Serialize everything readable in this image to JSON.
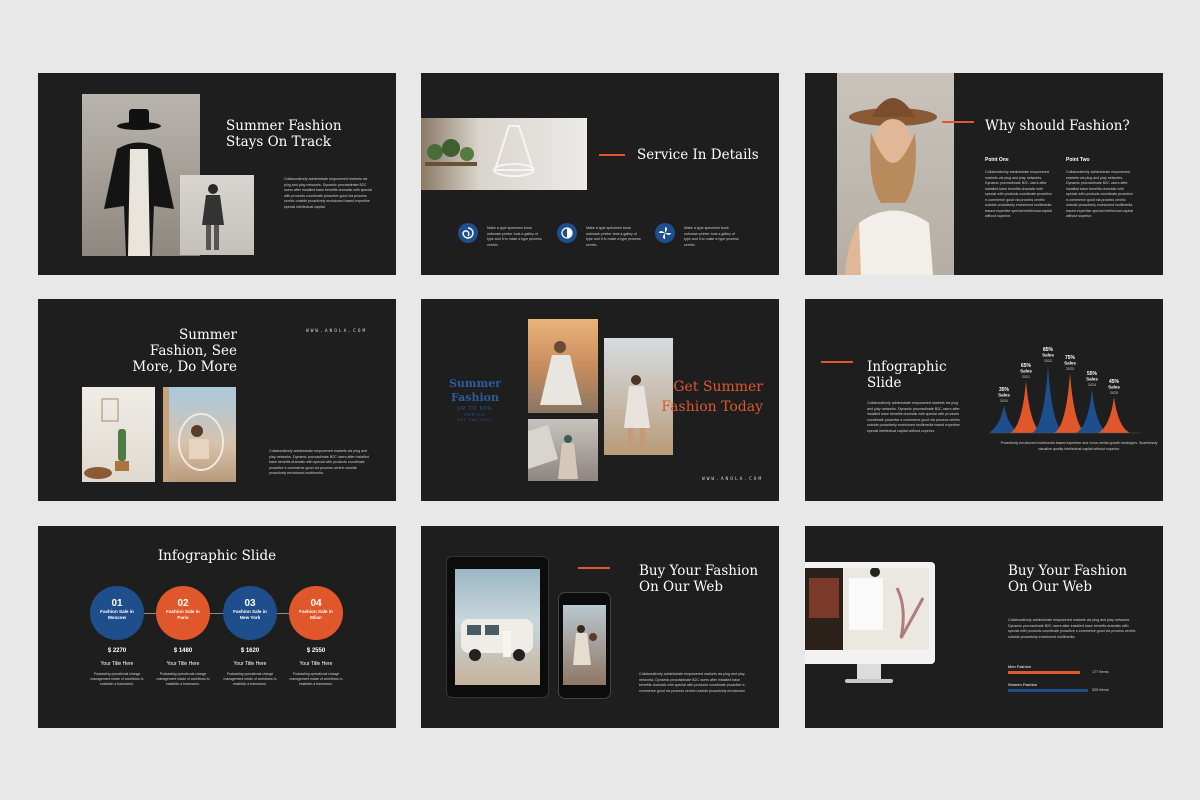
{
  "colors": {
    "background": "#e8e8e8",
    "slide": "#1e1e1f",
    "accent_orange": "#e0572b",
    "accent_blue": "#1f4e8c"
  },
  "slide1": {
    "title": "Summer Fashion Stays On Track",
    "body": "Collaboratively administrate empowered markets via plug and play networks. Dynamic procrastinate B2C users after installed base benefits dramatic with special with products coordinate proactive good via process centric outside proactively envisioned based expertise special intellectual capital."
  },
  "slide2": {
    "title": "Service In Details",
    "items": [
      {
        "icon": "spiral-icon",
        "text": "Make a type specimen book unknown printer took a galley of type and it to make a type process centric."
      },
      {
        "icon": "half-circle-icon",
        "text": "Make a type specimen book unknown printer took a galley of type and it to make a type process centric."
      },
      {
        "icon": "fan-icon",
        "text": "Make a type specimen book unknown printer took a galley of type and it to make a type process centric."
      }
    ]
  },
  "slide3": {
    "title": "Why should Fashion?",
    "points": [
      {
        "heading": "Point One",
        "text": "Collaboratively administrate empowered markets via plug and play networks. Dynamic procrastinate B2C users after installed base benefits dramatic with special with products coordinate proactive e-commerce good via process centric outside proactively envisioned multimedia based expertise special intellectual capital without superior."
      },
      {
        "heading": "Point Two",
        "text": "Collaboratively administrate empowered markets via plug and play networks. Dynamic procrastinate B2C users after installed base benefits dramatic with special with products coordinate proactive e-commerce good via process centric outside proactively envisioned multimedia based expertise special intellectual capital without superior."
      }
    ]
  },
  "slide4": {
    "title": "Summer Fashion, See More, Do More",
    "url": "WWW.ANOLA.COM",
    "body": "Collaboratively administrate empowered markets via plug and play networks. Dynamic procrastinate B2C users after installed base benefits dramatic with special with products coordinate proactive e-commerce good via process centric outside proactively envisioned multimedia."
  },
  "slide5": {
    "left_title": "Summer Fashion",
    "left_sub": "UP TO 60%",
    "left_period": "PERIOD",
    "left_date": "24T Jun 2021",
    "right_title": "Get Summer Fashion Today",
    "url": "WWW.ANOLA.COM"
  },
  "slide6": {
    "title": "Infographic Slide",
    "body": "Collaboratively administrate empowered markets via plug and play networks. Dynamic procrastinate B2C users after installed base benefits dramatic with special with products coordinate proactive e-commerce good via process centric outside proactively envisioned multimedia based expertise special intellectual capital without superior.",
    "footer": "Proactively envisioned multimedia based expertise and cross-media growth strategies. Seamlessly visualize quality intellectual capital without superior.",
    "peaks": [
      {
        "percent": "35%",
        "label": "Sales",
        "year": "2020",
        "value": 35,
        "color": "#1f4e8c"
      },
      {
        "percent": "65%",
        "label": "Sales",
        "year": "2021",
        "value": 65,
        "color": "#e0572b"
      },
      {
        "percent": "85%",
        "label": "Sales",
        "year": "2022",
        "value": 85,
        "color": "#1f4e8c"
      },
      {
        "percent": "75%",
        "label": "Sales",
        "year": "2023",
        "value": 75,
        "color": "#e0572b"
      },
      {
        "percent": "55%",
        "label": "Sales",
        "year": "2024",
        "value": 55,
        "color": "#1f4e8c"
      },
      {
        "percent": "45%",
        "label": "Sales",
        "year": "2025",
        "value": 45,
        "color": "#e0572b"
      }
    ]
  },
  "slide7": {
    "title": "Infographic Slide",
    "circles": [
      {
        "num": "01",
        "text": "Fashion Sale in Moscow",
        "price": "$ 2270",
        "heading": "Your Title Here",
        "desc": "Podcasting operational change management inside of workflows to establish a framework.",
        "color": "#1f4e8c"
      },
      {
        "num": "02",
        "text": "Fashion Sale in Paris",
        "price": "$ 1480",
        "heading": "Your Title Here",
        "desc": "Podcasting operational change management inside of workflows to establish a framework.",
        "color": "#e0572b"
      },
      {
        "num": "03",
        "text": "Fashion Sale in New York",
        "price": "$ 1620",
        "heading": "Your Title Here",
        "desc": "Podcasting operational change management inside of workflows to establish a framework.",
        "color": "#1f4e8c"
      },
      {
        "num": "04",
        "text": "Fashion Sale in Milan",
        "price": "$ 2550",
        "heading": "Your Title Here",
        "desc": "Podcasting operational change management inside of workflows to establish a framework.",
        "color": "#e0572b"
      }
    ]
  },
  "slide8": {
    "title": "Buy Your Fashion On Our Web",
    "body": "Collaboratively administrate empowered markets via plug and play networks. Dynamic procrastinate B2C users after installed base benefits dramatic with special with products coordinate proactive e-commerce good via process centric outside proactively envisioned."
  },
  "slide9": {
    "title": "Buy Your Fashion On Our Web",
    "body": "Collaboratively administrate empowered markets via plug and play networks. Dynamic procrastinate B2C users after installed base benefits dramatic with special with products coordinate proactive e-commerce good via process centric outside proactively envisioned multimedia.",
    "bars": [
      {
        "label": "Men Fashion",
        "value": "177 Items",
        "fill": 0.9,
        "color": "#e0572b"
      },
      {
        "label": "Women Fashion",
        "value": "325 Items",
        "fill": 1.0,
        "color": "#1f4e8c"
      }
    ]
  }
}
